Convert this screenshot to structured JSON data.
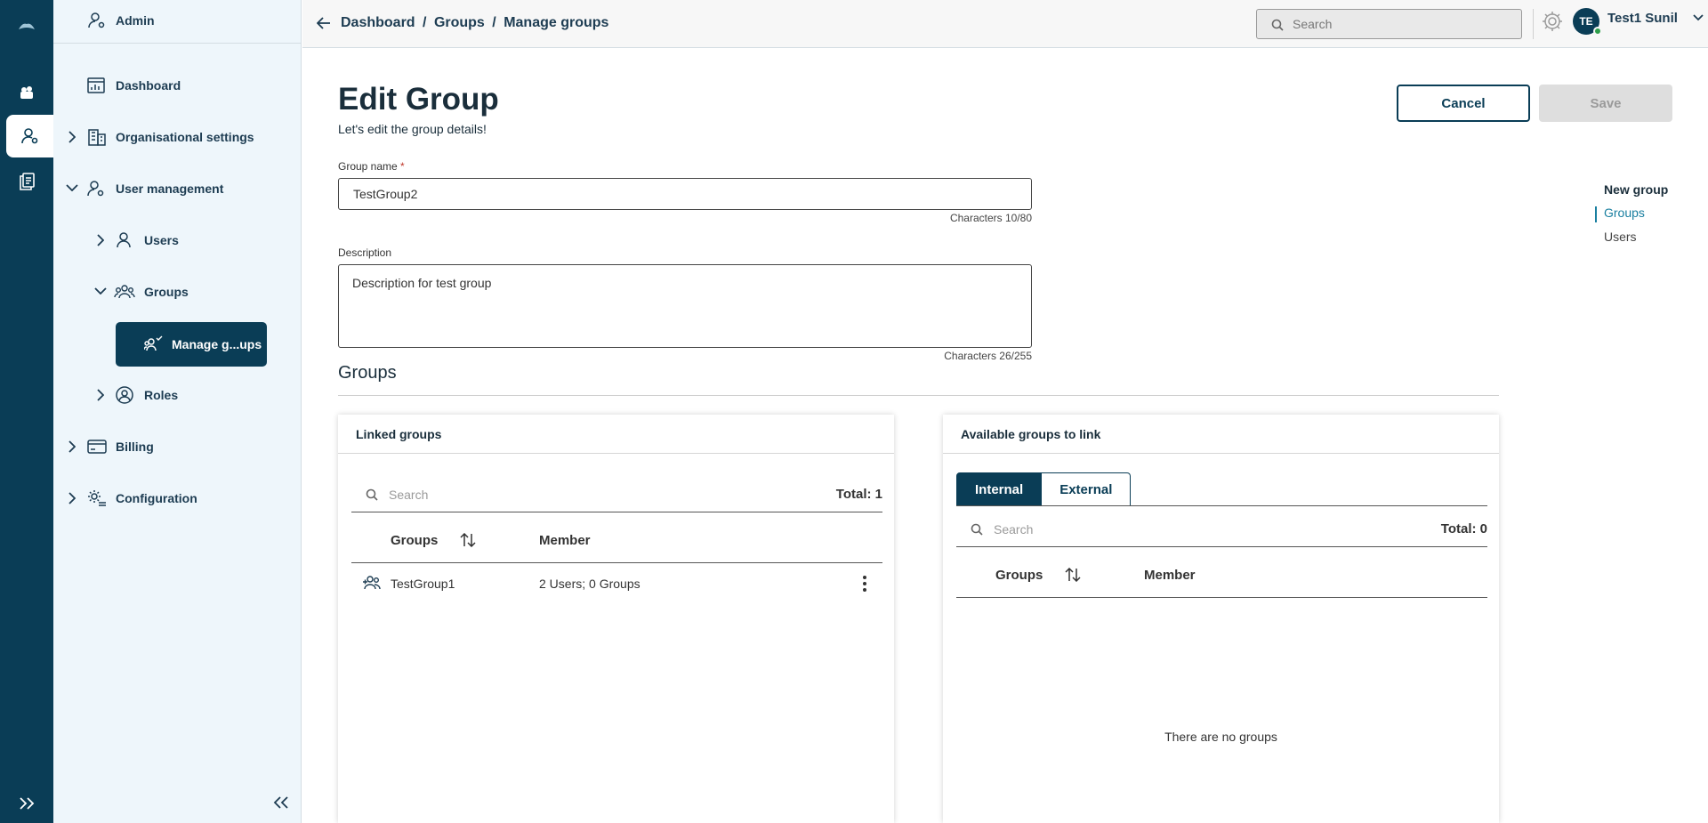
{
  "sidebar": {
    "header": "Admin",
    "items": [
      {
        "label": "Dashboard"
      },
      {
        "label": "Organisational settings"
      },
      {
        "label": "User management"
      },
      {
        "label": "Users"
      },
      {
        "label": "Groups"
      },
      {
        "label": "Manage g...ups"
      },
      {
        "label": "Roles"
      },
      {
        "label": "Billing"
      },
      {
        "label": "Configuration"
      }
    ]
  },
  "topbar": {
    "breadcrumb": [
      "Dashboard",
      "/",
      "Groups",
      "/",
      "Manage groups"
    ],
    "search_placeholder": "Search",
    "avatar_initials": "TE",
    "username": "Test1 Sunil"
  },
  "page": {
    "title": "Edit Group",
    "subtitle": "Let's edit the group details!",
    "cancel_label": "Cancel",
    "save_label": "Save"
  },
  "form": {
    "name_label": "Group name",
    "name_required": "*",
    "name_value": "TestGroup2",
    "name_counter": "Characters 10/80",
    "desc_label": "Description",
    "desc_value": "Description for test group",
    "desc_counter": "Characters 26/255"
  },
  "groups_section": {
    "title": "Groups",
    "linked": {
      "title": "Linked groups",
      "search_placeholder": "Search",
      "total": "Total: 1",
      "columns": [
        "Groups",
        "Member"
      ],
      "rows": [
        {
          "name": "TestGroup1",
          "member": "2 Users; 0 Groups"
        }
      ]
    },
    "available": {
      "title": "Available groups to link",
      "tabs": [
        "Internal",
        "External"
      ],
      "active_tab": "Internal",
      "search_placeholder": "Search",
      "total": "Total: 0",
      "columns": [
        "Groups",
        "Member"
      ],
      "empty_text": "There are no groups"
    }
  },
  "anchor_nav": {
    "items": [
      "New group",
      "Groups",
      "Users"
    ],
    "active": "Groups"
  },
  "colors": {
    "brand": "#0a3d56",
    "sidebar_bg": "#eef6fb",
    "anchor_active": "#1a7fa0",
    "status_online": "#2e9e4a"
  }
}
